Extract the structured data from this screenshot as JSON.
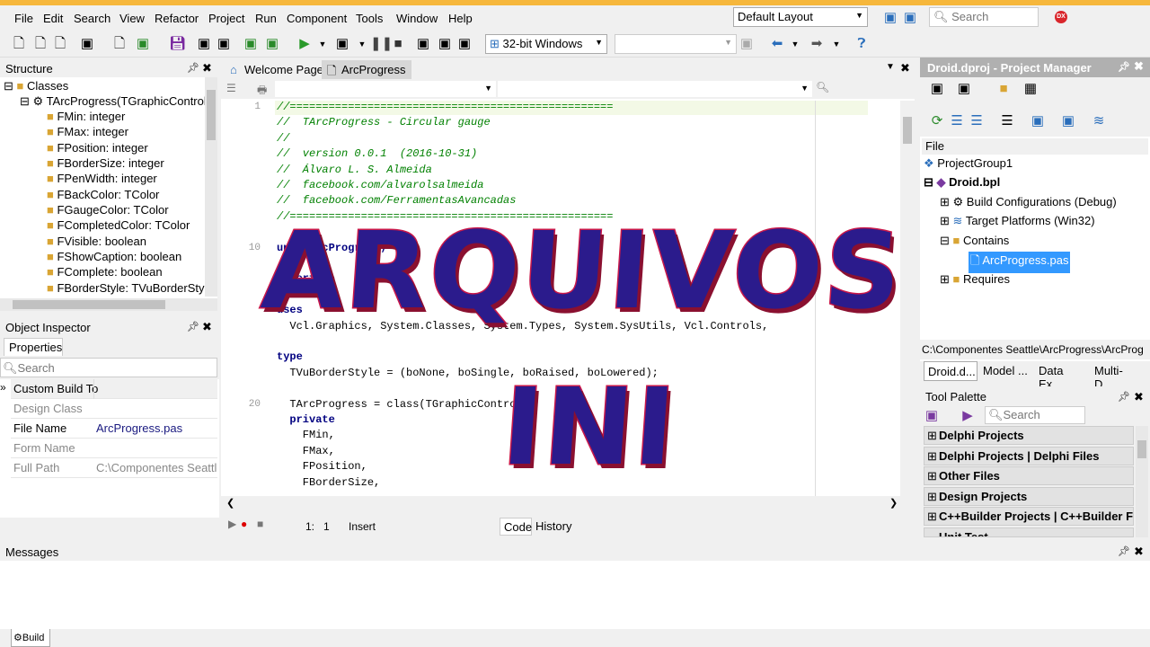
{
  "menu": [
    "File",
    "Edit",
    "Search",
    "View",
    "Refactor",
    "Project",
    "Run",
    "Component",
    "Tools",
    "Window",
    "Help"
  ],
  "layout": {
    "selected": "Default Layout"
  },
  "search": {
    "placeholder": "Search"
  },
  "toolbar": {
    "platform": "32-bit Windows"
  },
  "structure": {
    "title": "Structure",
    "root": "Classes",
    "class": "TArcProgress(TGraphicControl)",
    "fields": [
      "FMin: integer",
      "FMax: integer",
      "FPosition: integer",
      "FBorderSize: integer",
      "FPenWidth: integer",
      "FBackColor: TColor",
      "FGaugeColor: TColor",
      "FCompletedColor: TColor",
      "FVisible: boolean",
      "FShowCaption: boolean",
      "FComplete: boolean",
      "FBorderStyle: TVuBorderStyle"
    ]
  },
  "object_inspector": {
    "title": "Object Inspector",
    "tab": "Properties",
    "search_placeholder": "Search",
    "rows": [
      {
        "name": "Custom Build To",
        "value": ""
      },
      {
        "name": "Design Class",
        "value": ""
      },
      {
        "name": "File Name",
        "value": "ArcProgress.pas"
      },
      {
        "name": "Form Name",
        "value": ""
      },
      {
        "name": "Full Path",
        "value": "C:\\Componentes Seattle\\"
      }
    ]
  },
  "editor": {
    "tabs": [
      "Welcome Page",
      "ArcProgress"
    ],
    "lines": [
      {
        "n": "1",
        "text": "//==================================================",
        "cls": "cmt"
      },
      {
        "n": "",
        "text": "//  TArcProgress - Circular gauge",
        "cls": "cmt"
      },
      {
        "n": "",
        "text": "//",
        "cls": "cmt"
      },
      {
        "n": "",
        "text": "//  version 0.0.1  (2016-10-31)",
        "cls": "cmt"
      },
      {
        "n": "",
        "text": "//  Álvaro L. S. Almeida",
        "cls": "cmt"
      },
      {
        "n": "",
        "text": "//  facebook.com/alvarolsalmeida",
        "cls": "cmt"
      },
      {
        "n": "",
        "text": "//  facebook.com/FerramentasAvancadas",
        "cls": "cmt"
      },
      {
        "n": "",
        "text": "//==================================================",
        "cls": "cmt"
      },
      {
        "n": "",
        "text": "",
        "cls": ""
      },
      {
        "n": "10",
        "text": "unit ArcProgress;",
        "cls": "kw"
      },
      {
        "n": "",
        "text": "",
        "cls": ""
      },
      {
        "n": "",
        "text": "interface",
        "cls": "kw"
      },
      {
        "n": "",
        "text": "",
        "cls": ""
      },
      {
        "n": "",
        "text": "uses",
        "cls": "kw"
      },
      {
        "n": "",
        "text": "  Vcl.Graphics, System.Classes, System.Types, System.SysUtils, Vcl.Controls,",
        "cls": ""
      },
      {
        "n": "",
        "text": "",
        "cls": ""
      },
      {
        "n": "",
        "text": "type",
        "cls": "kw"
      },
      {
        "n": "",
        "text": "  TVuBorderStyle = (boNone, boSingle, boRaised, boLowered);",
        "cls": ""
      },
      {
        "n": "",
        "text": "",
        "cls": ""
      },
      {
        "n": "20",
        "text": "  TArcProgress = class(TGraphicControl)",
        "cls": ""
      },
      {
        "n": "",
        "text": "  private",
        "cls": "kw"
      },
      {
        "n": "",
        "text": "    FMin,",
        "cls": ""
      },
      {
        "n": "",
        "text": "    FMax,",
        "cls": ""
      },
      {
        "n": "",
        "text": "    FPosition,",
        "cls": ""
      },
      {
        "n": "",
        "text": "    FBorderSize,",
        "cls": ""
      }
    ]
  },
  "status": {
    "pos1": "1:",
    "pos2": "1",
    "mode": "Insert",
    "tabs": [
      "Code",
      "History"
    ]
  },
  "project_manager": {
    "title": "Droid.dproj - Project Manager",
    "column": "File",
    "group": "ProjectGroup1",
    "project": "Droid.bpl",
    "nodes": [
      "Build Configurations (Debug)",
      "Target Platforms (Win32)",
      "Contains",
      "ArcProgress.pas",
      "Requires"
    ],
    "path": "C:\\Componentes Seattle\\ArcProgress\\ArcProg",
    "tabs": [
      "Droid.d...",
      "Model ...",
      "Data Ex...",
      "Multi-D..."
    ]
  },
  "tool_palette": {
    "title": "Tool Palette",
    "search_placeholder": "Search",
    "categories": [
      "Delphi Projects",
      "Delphi Projects | Delphi Files",
      "Other Files",
      "Design Projects",
      "C++Builder Projects | C++Builder Files",
      "Unit Test"
    ]
  },
  "messages": {
    "title": "Messages",
    "tab": "Build"
  },
  "overlay": {
    "line1": "ARQUIVOS",
    "line2": "INI"
  }
}
